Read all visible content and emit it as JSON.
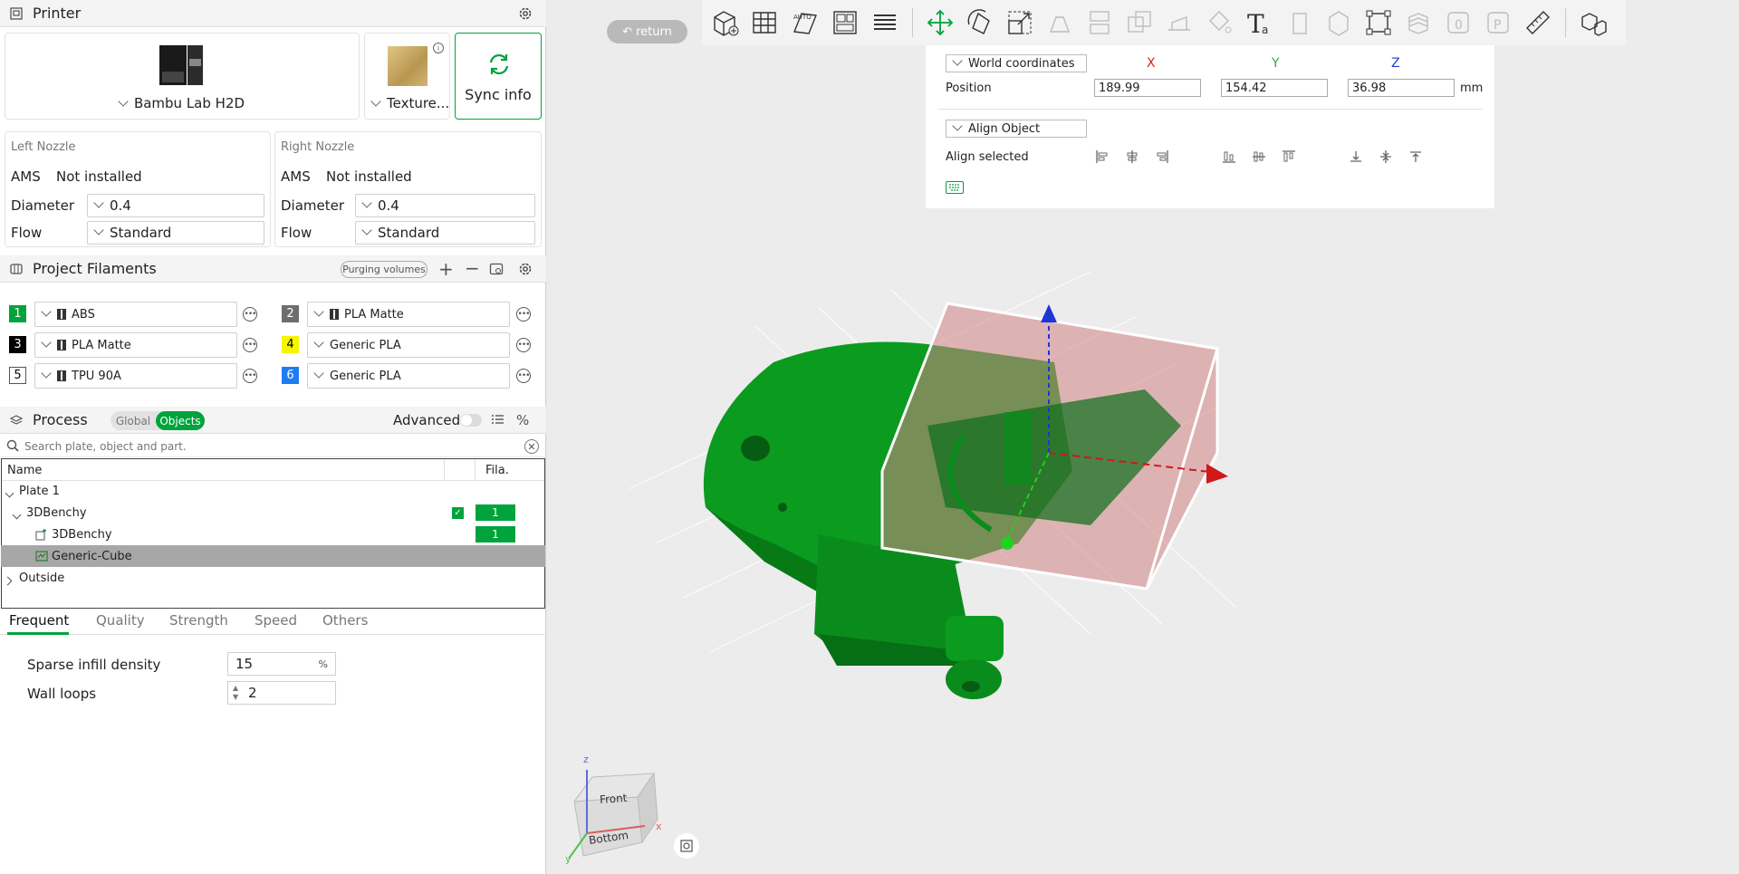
{
  "printer": {
    "title": "Printer",
    "model": "Bambu Lab H2D",
    "plate": "Texture...",
    "sync_label": "Sync info"
  },
  "left_nozzle": {
    "title": "Left Nozzle",
    "ams_label": "AMS",
    "ams_value": "Not installed",
    "diameter_label": "Diameter",
    "diameter_value": "0.4",
    "flow_label": "Flow",
    "flow_value": "Standard"
  },
  "right_nozzle": {
    "title": "Right Nozzle",
    "ams_label": "AMS",
    "ams_value": "Not installed",
    "diameter_label": "Diameter",
    "diameter_value": "0.4",
    "flow_label": "Flow",
    "flow_value": "Standard"
  },
  "filaments": {
    "title": "Project Filaments",
    "purge_label": "Purging volumes",
    "items": [
      {
        "num": "1",
        "name": "ABS",
        "color": "#00a33c",
        "text_color": "#ffffff",
        "spool": true
      },
      {
        "num": "2",
        "name": "PLA Matte",
        "color": "#6d6d6d",
        "text_color": "#ffffff",
        "spool": true
      },
      {
        "num": "3",
        "name": "PLA Matte",
        "color": "#000000",
        "text_color": "#ffffff",
        "spool": true
      },
      {
        "num": "4",
        "name": "Generic PLA",
        "color": "#f5f500",
        "text_color": "#000000",
        "spool": false
      },
      {
        "num": "5",
        "name": "TPU 90A",
        "color": "#ffffff",
        "text_color": "#000000",
        "spool": true
      },
      {
        "num": "6",
        "name": "Generic PLA",
        "color": "#1f7cf2",
        "text_color": "#ffffff",
        "spool": false
      }
    ]
  },
  "process": {
    "title": "Process",
    "toggle_global": "Global",
    "toggle_objects": "Objects",
    "advanced_label": "Advanced",
    "search_placeholder": "Search plate, object and part."
  },
  "object_tree": {
    "col_name": "Name",
    "col_fila": "Fila.",
    "plate": "Plate 1",
    "object": "3DBenchy",
    "object_fila": "1",
    "part": "3DBenchy",
    "part_fila": "1",
    "modifier": "Generic-Cube",
    "outside": "Outside"
  },
  "tabs": [
    "Frequent",
    "Quality",
    "Strength",
    "Speed",
    "Others"
  ],
  "params": {
    "infill_label": "Sparse infill density",
    "infill_value": "15",
    "infill_unit": "%",
    "walls_label": "Wall loops",
    "walls_value": "2"
  },
  "viewport": {
    "return_label": "return",
    "coord_mode": "World coordinates",
    "axis_x": "X",
    "axis_y": "Y",
    "axis_z": "Z",
    "position_label": "Position",
    "pos_x": "189.99",
    "pos_y": "154.42",
    "pos_z": "36.98",
    "unit": "mm",
    "align_mode": "Align Object",
    "align_label": "Align selected",
    "cube_front": "Front",
    "cube_bottom": "Bottom",
    "cube_z": "z",
    "cube_x": "x",
    "cube_y": "y"
  },
  "colors": {
    "accent": "#00a33c",
    "model_green": "#0b9b1f",
    "modifier_red": "#d28484"
  }
}
